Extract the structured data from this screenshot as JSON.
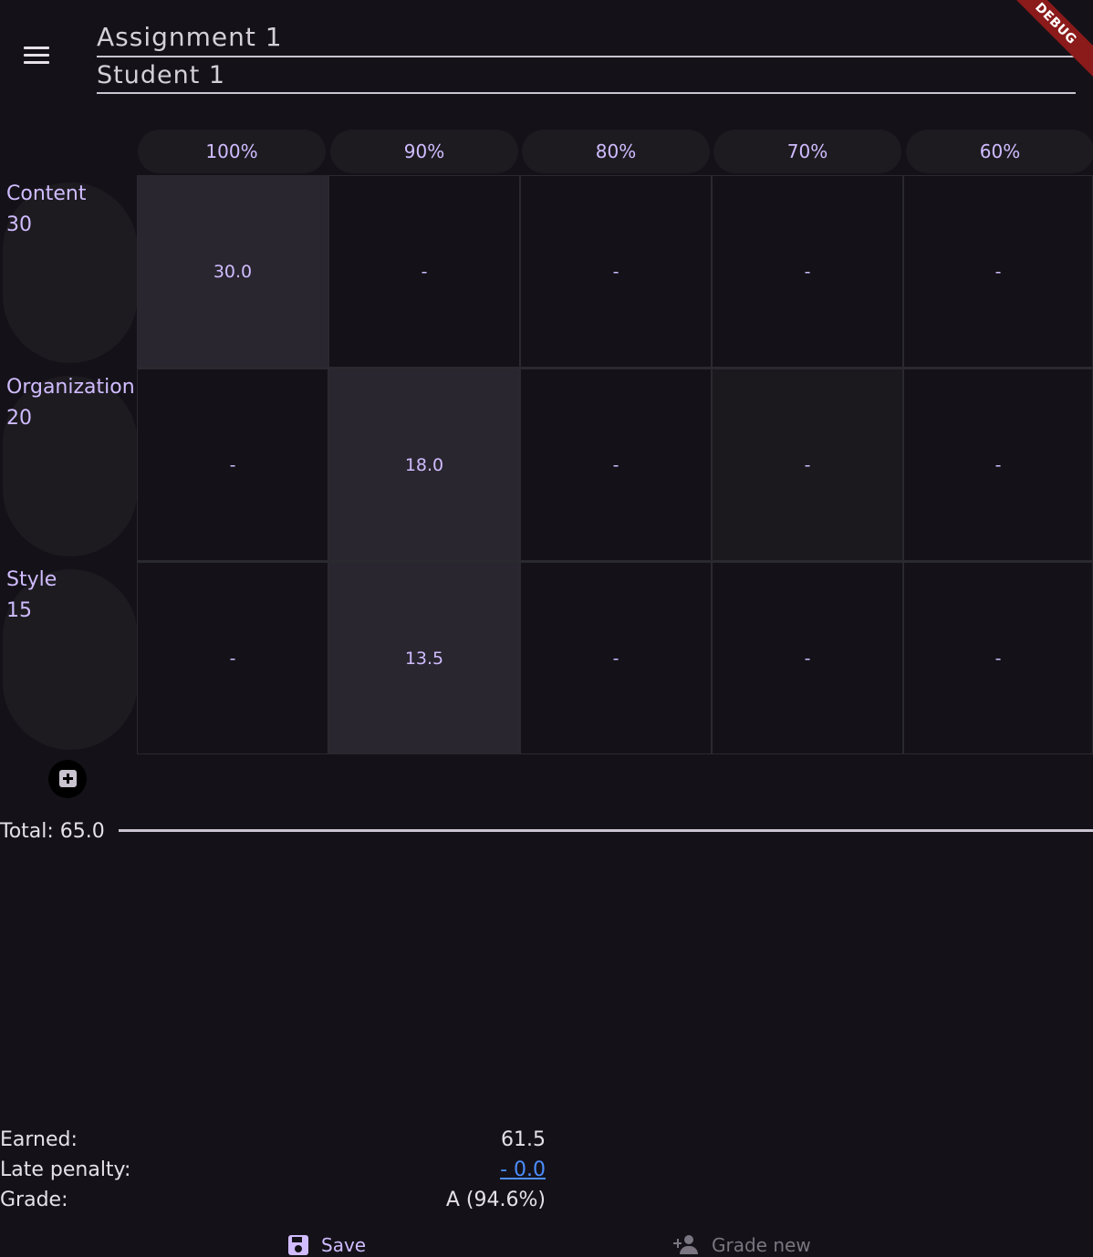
{
  "header": {
    "assignment_title": "Assignment 1",
    "student_name": "Student 1",
    "debug_banner": "DEBUG"
  },
  "rubric": {
    "levels": [
      "100%",
      "90%",
      "80%",
      "70%",
      "60%"
    ],
    "criteria": [
      {
        "name": "Content",
        "points": "30",
        "cells": [
          "30.0",
          "-",
          "-",
          "-",
          "-"
        ],
        "selected_level": 0
      },
      {
        "name": "Organization",
        "points": "20",
        "cells": [
          "-",
          "18.0",
          "-",
          "-",
          "-"
        ],
        "selected_level": 1
      },
      {
        "name": "Style",
        "points": "15",
        "cells": [
          "-",
          "13.5",
          "-",
          "-",
          "-"
        ],
        "selected_level": 1
      }
    ]
  },
  "total": {
    "label": "Total: 65.0"
  },
  "summary": {
    "earned_label": "Earned:",
    "earned_value": "61.5",
    "late_penalty_label": "Late penalty:",
    "late_penalty_value": "- 0.0",
    "grade_label": "Grade:",
    "grade_value": "A (94.6%)"
  },
  "actions": {
    "save_label": "Save",
    "grade_new_label": "Grade new"
  },
  "icons": {
    "menu": "menu-icon",
    "add": "add-box-icon",
    "save": "save-icon",
    "grade_new": "person-add-icon"
  },
  "colors": {
    "background": "#141218",
    "accent": "#d0bcff",
    "selected_cell": "#29262f",
    "link": "#4c8dff",
    "debug": "#8b1a1a"
  }
}
